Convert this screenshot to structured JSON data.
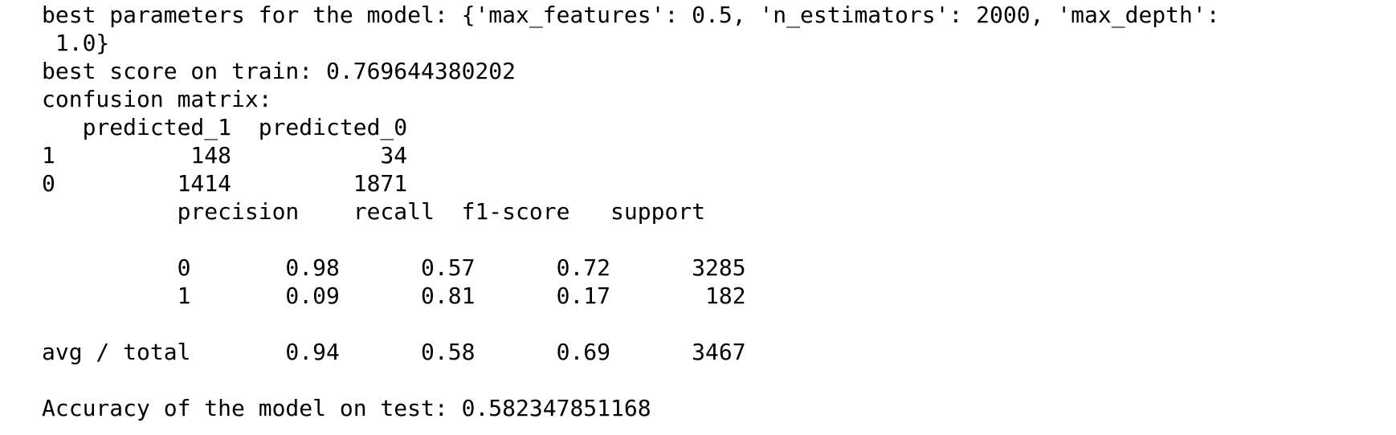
{
  "output": {
    "best_params_line_1": "best parameters for the model: {'max_features': 0.5, 'n_estimators': 2000, 'max_depth':",
    "best_params_line_2": " 1.0}",
    "best_score_line": "best score on train: 0.769644380202",
    "confusion_matrix_label": "confusion matrix:",
    "confusion_matrix_header": "   predicted_1  predicted_0",
    "confusion_matrix_row_1": "1          148           34",
    "confusion_matrix_row_0": "0         1414         1871",
    "report_header": "          precision    recall  f1-score   support",
    "report_blank_1": "",
    "report_row_0": "          0       0.98      0.57      0.72      3285",
    "report_row_1": "          1       0.09      0.81      0.17       182",
    "report_blank_2": "",
    "report_avg_total": "avg / total       0.94      0.58      0.69      3467",
    "report_blank_3": "",
    "accuracy_line": "Accuracy of the model on test: 0.582347851168"
  },
  "colors": {
    "background": "#ffffff",
    "text": "#000000"
  }
}
